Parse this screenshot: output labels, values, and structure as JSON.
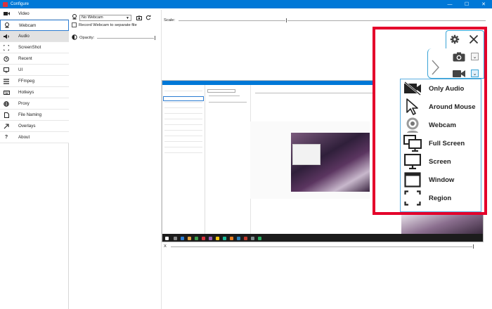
{
  "window": {
    "title": "Configure",
    "minimize_glyph": "—",
    "maximize_glyph": "☐",
    "close_glyph": "✕"
  },
  "sidebar": {
    "items": [
      {
        "label": "Video",
        "icon": "video-camera-icon"
      },
      {
        "label": "Webcam",
        "icon": "webcam-icon",
        "selected": true
      },
      {
        "label": "Audio",
        "icon": "speaker-icon",
        "hover": true
      },
      {
        "label": "ScreenShot",
        "icon": "crop-frame-icon"
      },
      {
        "label": "Recent",
        "icon": "history-icon"
      },
      {
        "label": "UI",
        "icon": "display-icon"
      },
      {
        "label": "FFmpeg",
        "icon": "ffmpeg-icon"
      },
      {
        "label": "Hotkeys",
        "icon": "keyboard-icon"
      },
      {
        "label": "Proxy",
        "icon": "globe-icon"
      },
      {
        "label": "File Naming",
        "icon": "file-icon"
      },
      {
        "label": "Overlays",
        "icon": "arrow-icon"
      },
      {
        "label": "About",
        "icon": "question-icon"
      }
    ]
  },
  "webcam_settings": {
    "webcam_select": "No Webcam",
    "separate_file_label": "Record Webcam to separate file",
    "separate_file_checked": false,
    "opacity_label": "Opacity:",
    "opacity_level": 1.0
  },
  "preview": {
    "scale_label": "Scale:",
    "scale_level": 0.35,
    "x_label": "X",
    "x_level": 1.0
  },
  "callout": {
    "border_color": "#e4002b",
    "accent_color": "#39a3d6",
    "menu_items": [
      {
        "label": "Only Audio",
        "icon": "no-video-icon"
      },
      {
        "label": "Around Mouse",
        "icon": "cursor-icon"
      },
      {
        "label": "Webcam",
        "icon": "webcam-icon"
      },
      {
        "label": "Full Screen",
        "icon": "multi-monitor-icon"
      },
      {
        "label": "Screen",
        "icon": "monitor-icon"
      },
      {
        "label": "Window",
        "icon": "window-icon"
      },
      {
        "label": "Region",
        "icon": "region-icon"
      }
    ]
  }
}
